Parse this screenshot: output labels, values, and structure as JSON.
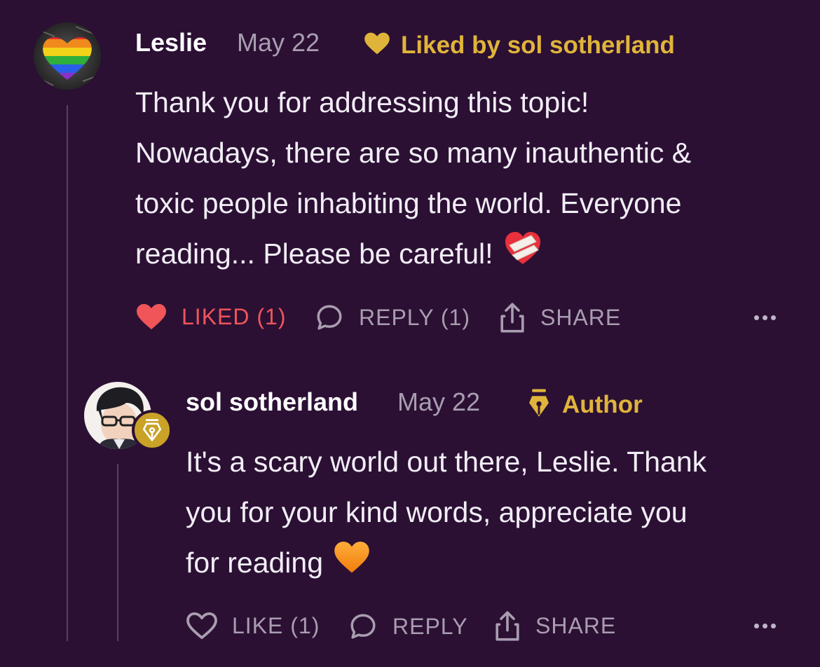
{
  "colors": {
    "background": "#2b1034",
    "accent_gold": "#e0b43a",
    "liked_red": "#f0555a",
    "muted": "#a99db0"
  },
  "comment": {
    "author": "Leslie",
    "date": "May 22",
    "liked_by": "Liked by sol sotherland",
    "body_lines": [
      "Thank you for addressing this topic!",
      "Nowadays, there are so many inauthentic &",
      "toxic people inhabiting the world. Everyone",
      "reading... Please be careful!"
    ],
    "body_emoji": "mending-heart-icon",
    "actions": {
      "like_label": "LIKED (1)",
      "reply_label": "REPLY (1)",
      "share_label": "SHARE"
    }
  },
  "reply": {
    "author": "sol sotherland",
    "date": "May 22",
    "badge_label": "Author",
    "body_lines": [
      "It's a scary world out there, Leslie. Thank",
      "you for your kind words, appreciate you",
      "for reading"
    ],
    "body_emoji": "orange-heart-icon",
    "actions": {
      "like_label": "LIKE (1)",
      "reply_label": "REPLY",
      "share_label": "SHARE"
    }
  }
}
